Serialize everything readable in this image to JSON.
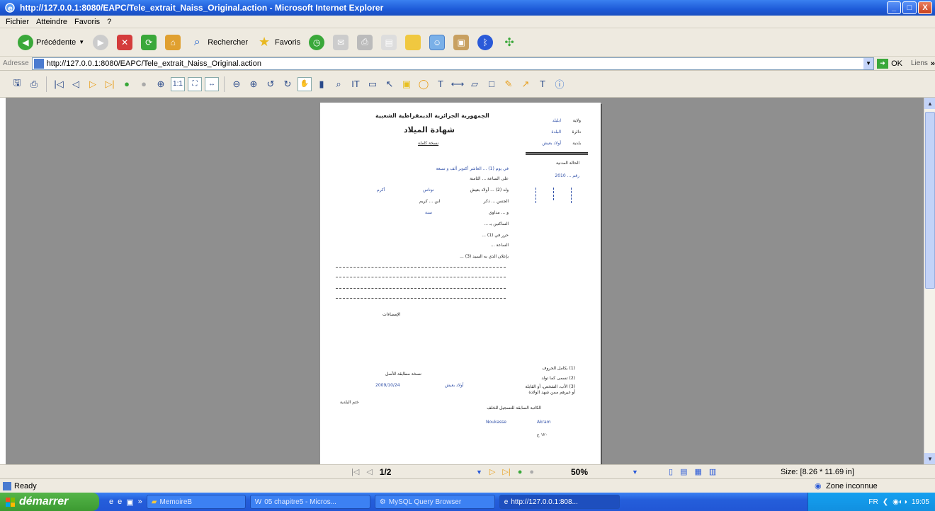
{
  "window": {
    "title": "http://127.0.0.1:8080/EAPC/Tele_extrait_Naiss_Original.action - Microsoft Internet Explorer",
    "min": "_",
    "max": "□",
    "close": "X"
  },
  "menu": {
    "items": [
      "Fichier",
      "Atteindre",
      "Favoris",
      "?"
    ]
  },
  "toolbar": {
    "back_label": "Précédente",
    "search_label": "Rechercher",
    "favorites_label": "Favoris"
  },
  "address": {
    "label": "Adresse",
    "url": "http://127.0.0.1:8080/EAPC/Tele_extrait_Naiss_Original.action",
    "go_label": "OK",
    "links_label": "Liens"
  },
  "document": {
    "header_right_1": "ولاية",
    "header_right_1_val": "ابلبلد",
    "header_right_2": "دائرة",
    "header_right_2_val": "البلدة",
    "header_right_3": "بلدية",
    "header_right_3_val": "أولاد بعيش",
    "republic": "الجمهورية الجزائرية الديمقراطية الشعبية",
    "cert_title": "شهادة الميلاد",
    "copy_type": "نسخة كاملة",
    "civil_status": "الحالة المدنية",
    "reg_number": "رقم ... 2010",
    "line_day": "في يوم (1) ... العاشر أكتوبر ألف و تسعة",
    "line_hour": "على الساعة ... الثامنة",
    "line_born": "ولد (2) ... أولاد بعيش",
    "line_born_val1": "نوناس",
    "line_born_val2": "أكرم",
    "line_sex": "الجنس ... ذكر",
    "line_son_of": "ابن ... كريم",
    "line_and": "و ... مداوي",
    "line_age": "سنة",
    "line_resident": "الساكنين بـ ...",
    "line_written": "حرر في (1) ...",
    "line_hour2": "الساعة ...",
    "line_declared": "بإعلان الذي به السيد (3) ...",
    "signatures": "الإمضاءات",
    "certified": "نسخة مطابقة للأصل",
    "cert_place": "أولاد بعيش",
    "cert_date": "2009/10/24",
    "seal": "ختم البلدية",
    "note_1": "(1) بكامل الحروف",
    "note_2": "(2) تسمى كما تولد",
    "note_3": "(3) الأب، الشخص، أو القابلة",
    "note_3b": "أو غيرهم ممن شهد الولادة",
    "officer": "الكاتبة السابقة للتسجيل للخلف",
    "name_latin_1": "Noukasse",
    "name_latin_2": "Akram",
    "page_no": "١٢٠ ع"
  },
  "viewer_nav": {
    "page_counter": "1/2",
    "zoom": "50%",
    "size": "Size: [8.26 * 11.69 in]"
  },
  "status": {
    "ready": "Ready",
    "zone": "Zone inconnue"
  },
  "taskbar": {
    "start_label": "démarrer",
    "tasks": [
      "MemoireB",
      "05 chapitre5 - Micros...",
      "MySQL Query Browser",
      "http://127.0.0.1:808..."
    ],
    "lang": "FR",
    "time": "19:05"
  }
}
